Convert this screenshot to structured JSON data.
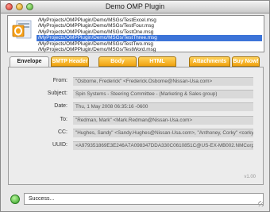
{
  "window": {
    "title": "Demo OMP Plugin"
  },
  "files": [
    "/MyProjects/OMPPlugin/Demo/MSGs/TestExcel.msg",
    "/MyProjects/OMPPlugin/Demo/MSGs/TestFour.msg",
    "/MyProjects/OMPPlugin/Demo/MSGs/TestOne.msg",
    "/MyProjects/OMPPlugin/Demo/MSGs/TestThree.msg",
    "/MyProjects/OMPPlugin/Demo/MSGs/TestTwo.msg",
    "/MyProjects/OMPPlugin/Demo/MSGs/TestWord.msg"
  ],
  "selected_file_index": 3,
  "tabs": [
    "Envelope",
    "SMTP Header",
    "Body",
    "HTML",
    "Attachments",
    "Buy Now!"
  ],
  "active_tab": "Envelope",
  "envelope": {
    "from_label": "From:",
    "from_value": "\"Osborne, Frederick\" <Frederick.Osborne@Nissan-Usa.com>",
    "subject_label": "Subject:",
    "subject_value": "Spin Systems - Steering Committee - (Marketing & Sales group)",
    "date_label": "Date:",
    "date_value": "Thu, 1 May 2008 06:35:16 -0600",
    "to_label": "To:",
    "to_value": "\"Redman, Mark\" <Mark.Redman@Nissan-Usa.com>",
    "cc_label": "CC:",
    "cc_value": "\"Hughes, Sandy\" <Sandy.Hughes@Nissan-Usa.com>, \"Anthoney, Corky\" <corky",
    "uuid_label": "UUID:",
    "uuid_value": "<A979351869E3E246A7A098347DDA330C0610851C@US-EX-MB002.NMCorp."
  },
  "version": "v1.00",
  "status": {
    "text": "Success..."
  },
  "colors": {
    "tab": "#f0a20e",
    "selection": "#3c74d8",
    "status_ok": "#2d9b1e"
  }
}
